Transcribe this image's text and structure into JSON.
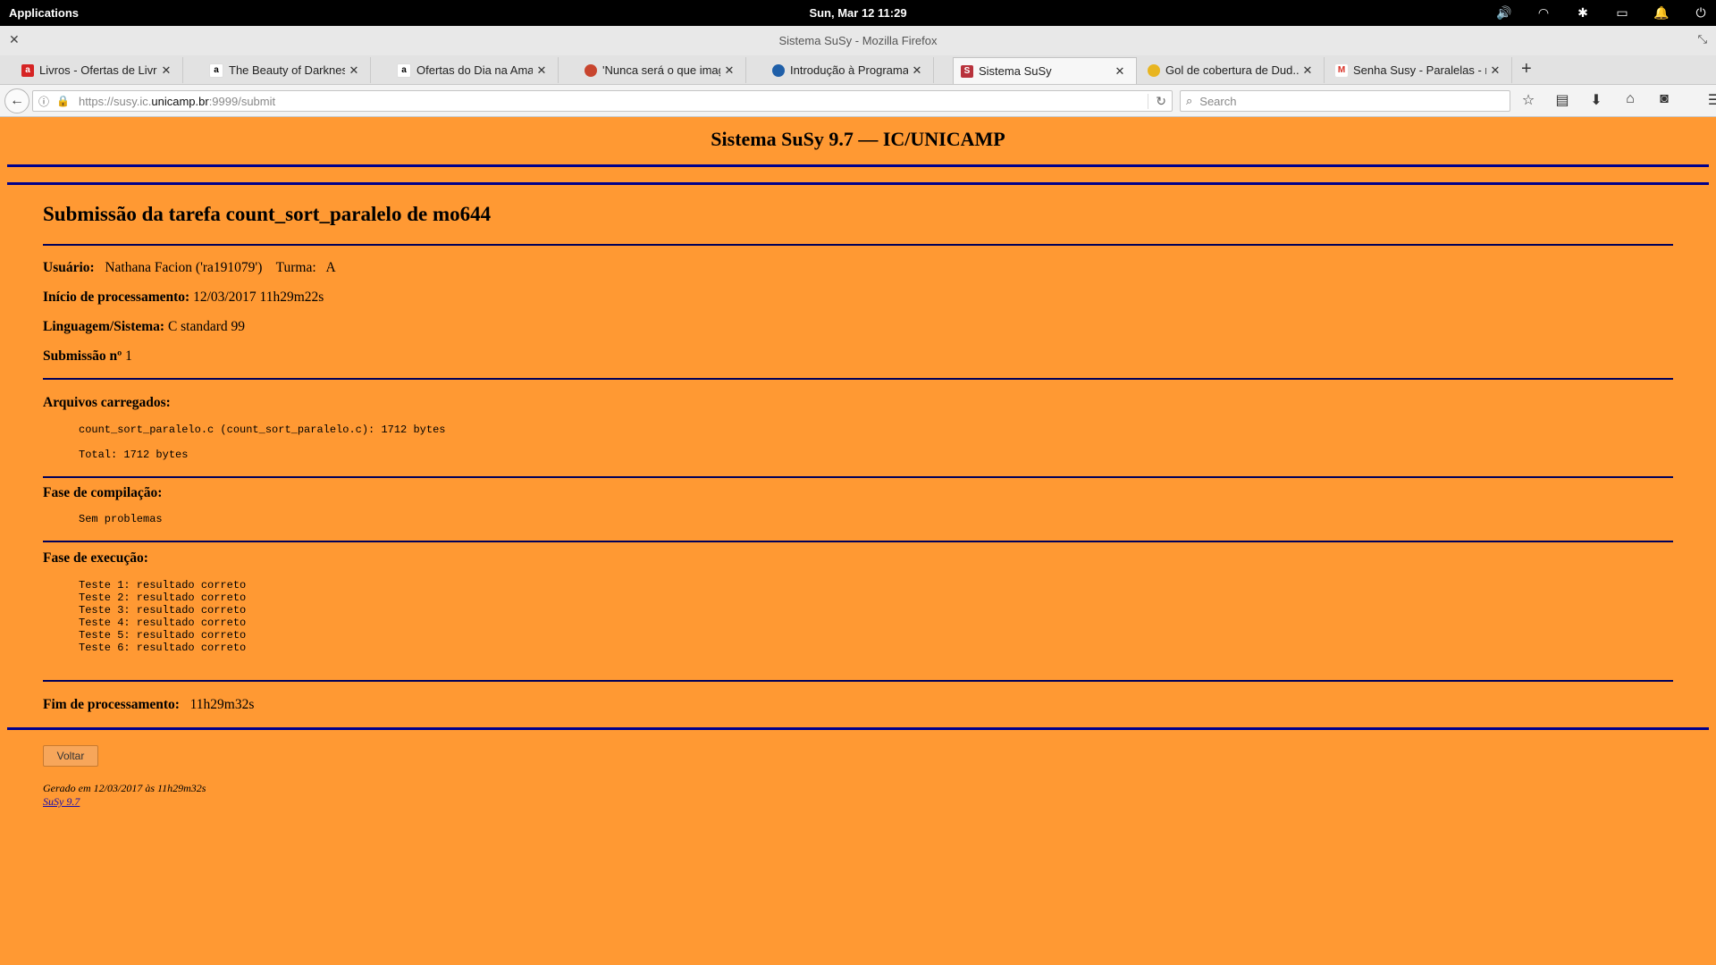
{
  "topbar": {
    "applications": "Applications",
    "clock": "Sun, Mar 12   11:29"
  },
  "window": {
    "title": "Sistema SuSy - Mozilla Firefox"
  },
  "tabs": [
    {
      "label": "Livros - Ofertas de Livros ...",
      "favicon_color": "#d62424",
      "favicon_glyph": "a"
    },
    {
      "label": "The Beauty of Darkness - ...",
      "favicon_color": "#ffffff",
      "favicon_glyph": "a"
    },
    {
      "label": "Ofertas do Dia na Amazo...",
      "favicon_color": "#ffffff",
      "favicon_glyph": "a"
    },
    {
      "label": "'Nunca será o que imagin...",
      "favicon_color": "#c8452e",
      "favicon_glyph": "●"
    },
    {
      "label": "Introdução à Programaçã...",
      "favicon_color": "#1f5fa8",
      "favicon_glyph": "●"
    },
    {
      "label": "Sistema SuSy",
      "favicon_color": "#b8323c",
      "favicon_glyph": "S",
      "active": true
    },
    {
      "label": "Gol de cobertura de Dud...",
      "favicon_color": "#e8b520",
      "favicon_glyph": "●"
    },
    {
      "label": "Senha Susy - Paralelas - n...",
      "favicon_color": "#ffffff",
      "favicon_glyph": "M"
    }
  ],
  "nav": {
    "url_prefix": "https://susy.ic.",
    "url_domain": "unicamp.br",
    "url_suffix": ":9999/submit",
    "search_placeholder": "Search"
  },
  "page": {
    "header_title": "Sistema SuSy 9.7 — IC/UNICAMP",
    "heading": "Submissão da tarefa count_sort_paralelo de mo644",
    "usuario_label": "Usuário:",
    "usuario_value": "Nathana Facion ('ra191079')",
    "turma_label": "Turma:",
    "turma_value": "A",
    "inicio_label": "Início de processamento:",
    "inicio_value": "12/03/2017  11h29m22s",
    "linguagem_label": "Linguagem/Sistema:",
    "linguagem_value": "C standard 99",
    "submissao_label": "Submissão nº",
    "submissao_value": "1",
    "arquivos_label": "Arquivos carregados:",
    "arquivo_line": "count_sort_paralelo.c (count_sort_paralelo.c):  1712 bytes",
    "total_line": "Total: 1712 bytes",
    "compilacao_label": "Fase de compilação:",
    "compilacao_value": "Sem problemas",
    "execucao_label": "Fase de execução:",
    "tests": [
      "Teste 1: resultado correto",
      "Teste 2: resultado correto",
      "Teste 3: resultado correto",
      "Teste 4: resultado correto",
      "Teste 5: resultado correto",
      "Teste 6: resultado correto"
    ],
    "fim_label": "Fim de processamento:",
    "fim_value": "11h29m32s",
    "voltar_label": "Voltar",
    "footer_generated": "Gerado em 12/03/2017 às 11h29m32s",
    "footer_link": "SuSy 9.7"
  }
}
